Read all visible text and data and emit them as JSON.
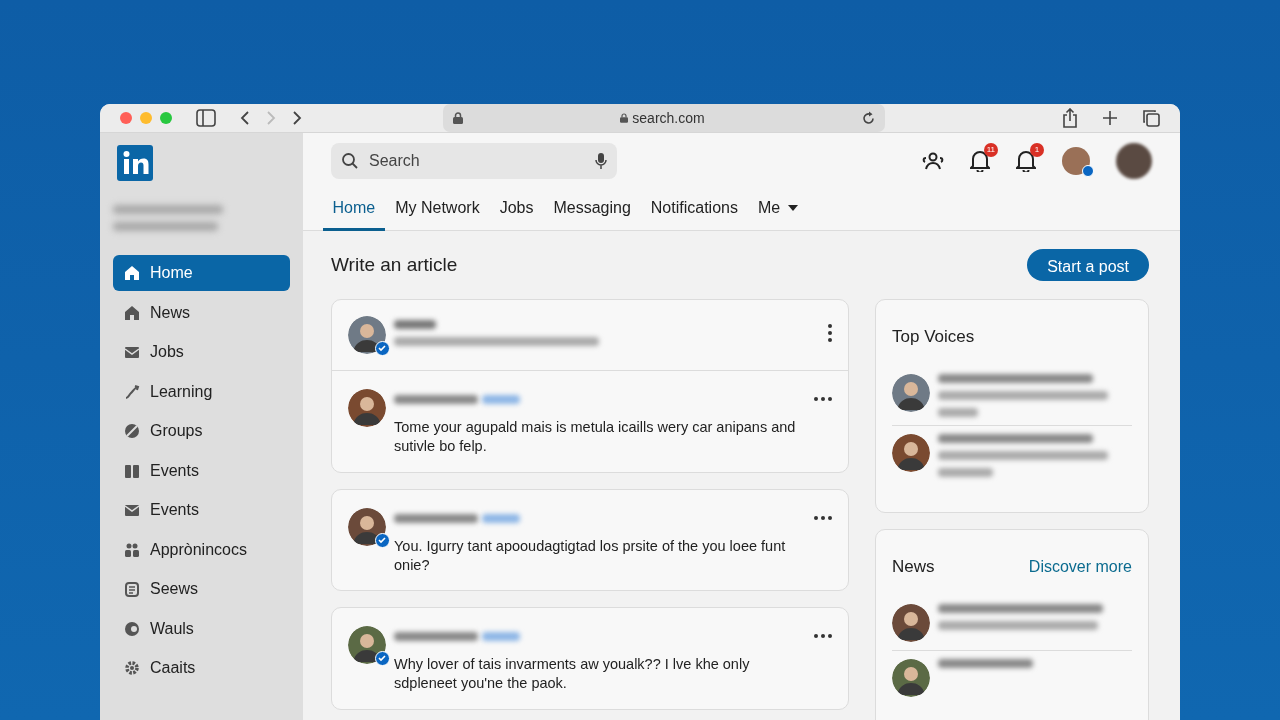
{
  "browser": {
    "url": "search.com"
  },
  "header": {
    "search": {
      "placeholder": "Search"
    },
    "badges": [
      "11",
      "1"
    ]
  },
  "sidebar": {
    "items": [
      {
        "label": "Home",
        "selected": true
      },
      {
        "label": "News",
        "selected": false
      },
      {
        "label": "Jobs",
        "selected": false
      },
      {
        "label": "Learning",
        "selected": false
      },
      {
        "label": "Groups",
        "selected": false
      },
      {
        "label": "Events",
        "selected": false
      },
      {
        "label": "Events",
        "selected": false
      },
      {
        "label": "Apprònincocs",
        "selected": false
      },
      {
        "label": "Seews",
        "selected": false
      },
      {
        "label": "Wauls",
        "selected": false
      },
      {
        "label": "Caaits",
        "selected": false
      }
    ]
  },
  "tabs": [
    {
      "label": "Home",
      "selected": true
    },
    {
      "label": "My Network",
      "selected": false
    },
    {
      "label": "Jobs",
      "selected": false
    },
    {
      "label": "Messaging",
      "selected": false
    },
    {
      "label": "Notifications",
      "selected": false
    },
    {
      "label": "Me",
      "selected": false
    }
  ],
  "feed": {
    "title": "Write an article",
    "action": "Start a post",
    "cards": [
      {
        "posts": [
          {
            "kind": "composer",
            "verified": true
          },
          {
            "kind": "post",
            "verified": false,
            "text": "Tome your agupald mais is metula icaills wery car anipans and sutivle bo felp."
          }
        ]
      },
      {
        "posts": [
          {
            "kind": "post",
            "verified": true,
            "text": "You. Igurry tant apooudagtigtad los prsite of the you loee funt onie?"
          }
        ]
      },
      {
        "posts": [
          {
            "kind": "post",
            "verified": true,
            "text": "Why lover of tais invarments aw youalk?? I lve khe only sdpleneet you'ne the paok."
          }
        ]
      }
    ]
  },
  "top_voices": {
    "title": "Top Voices"
  },
  "news": {
    "title": "News",
    "link": "Discover more"
  }
}
